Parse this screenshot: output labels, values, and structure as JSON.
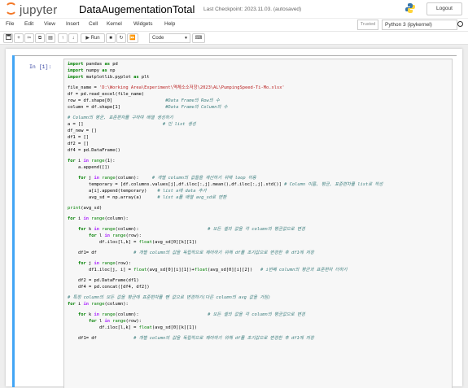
{
  "header": {
    "logo_text": "jupyter",
    "notebook_name": "DataAugementationTotal",
    "checkpoint": "Last Checkpoint: 2023.11.03.",
    "autosave": "(autosaved)",
    "logout_label": "Logout"
  },
  "menu": {
    "items": [
      "File",
      "Edit",
      "View",
      "Insert",
      "Cell",
      "Kernel",
      "Widgets",
      "Help"
    ],
    "trusted": "Trusted",
    "kernel_name": "Python 3 (ipykernel)"
  },
  "toolbar": {
    "run_label": "Run",
    "cell_type": "Code"
  },
  "cell": {
    "prompt": "In [1]:",
    "lines": [
      [
        [
          "kw",
          "import"
        ],
        [
          "t",
          " pandas "
        ],
        [
          "kw",
          "as"
        ],
        [
          "t",
          " pd"
        ]
      ],
      [
        [
          "kw",
          "import"
        ],
        [
          "t",
          " numpy "
        ],
        [
          "kw",
          "as"
        ],
        [
          "t",
          " np"
        ]
      ],
      [
        [
          "kw",
          "import"
        ],
        [
          "t",
          " matplotlib.pyplot "
        ],
        [
          "kw",
          "as"
        ],
        [
          "t",
          " plt"
        ]
      ],
      [],
      [
        [
          "t",
          "file_name = "
        ],
        [
          "str",
          "'D:\\Working Area\\Experiment\\역체소소저장\\2023\\AL\\PumpingSpeed-Ti-Mo.xlsx'"
        ]
      ],
      [
        [
          "t",
          "df = pd.read_excel(file_name)"
        ]
      ],
      [
        [
          "t",
          "row = df.shape[0]                    "
        ],
        [
          "cm",
          "#Data Frame의 Row의 수"
        ]
      ],
      [
        [
          "t",
          "column = df.shape[1]                 "
        ],
        [
          "cm",
          "#Data Frame의 Column의 수"
        ]
      ],
      [],
      [
        [
          "cm",
          "# Column의 평균, 표준편차를 구하여 배열 생성하기"
        ]
      ],
      [
        [
          "t",
          "a = []                              "
        ],
        [
          "cm",
          "# 빈 list 생성"
        ]
      ],
      [
        [
          "t",
          "df_new = []"
        ]
      ],
      [
        [
          "t",
          "df1 = []"
        ]
      ],
      [
        [
          "t",
          "df2 = []"
        ]
      ],
      [
        [
          "t",
          "df4 = pd.DataFrame()"
        ]
      ],
      [],
      [
        [
          "kw",
          "for"
        ],
        [
          "t",
          " i "
        ],
        [
          "op",
          "in"
        ],
        [
          "t",
          " "
        ],
        [
          "bi",
          "range"
        ],
        [
          "t",
          "(1):"
        ]
      ],
      [
        [
          "t",
          "    a.append([])"
        ]
      ],
      [],
      [
        [
          "t",
          "    "
        ],
        [
          "kw",
          "for"
        ],
        [
          "t",
          " j "
        ],
        [
          "op",
          "in"
        ],
        [
          "t",
          " "
        ],
        [
          "bi",
          "range"
        ],
        [
          "t",
          "(column):     "
        ],
        [
          "cm",
          "# 개별 column의 값들을 계산하기 위해 loop 이용"
        ]
      ],
      [
        [
          "t",
          "        temporary = [df.columns.values[j],df.iloc[:,j].mean(),df.iloc[:,j].std()] "
        ],
        [
          "cm",
          "# Column 이름, 평균, 표준편차를 list로 작성"
        ]
      ],
      [
        [
          "t",
          "        a[i].append(temporary)    "
        ],
        [
          "cm",
          "# list a에 data 추가"
        ]
      ],
      [
        [
          "t",
          "        avg_sd = np.array(a)      "
        ],
        [
          "cm",
          "# list a를 배열 avg_sd로 변환"
        ]
      ],
      [],
      [
        [
          "bi",
          "print"
        ],
        [
          "t",
          "(avg_sd)"
        ]
      ],
      [],
      [
        [
          "kw",
          "for"
        ],
        [
          "t",
          " i "
        ],
        [
          "op",
          "in"
        ],
        [
          "t",
          " "
        ],
        [
          "bi",
          "range"
        ],
        [
          "t",
          "(column):"
        ]
      ],
      [],
      [
        [
          "t",
          "    "
        ],
        [
          "kw",
          "for"
        ],
        [
          "t",
          " k "
        ],
        [
          "op",
          "in"
        ],
        [
          "t",
          " "
        ],
        [
          "bi",
          "range"
        ],
        [
          "t",
          "(column):                          "
        ],
        [
          "cm",
          "# 모든 셀의 값을 각 column의 평균값으로 변경"
        ]
      ],
      [
        [
          "t",
          "        "
        ],
        [
          "kw",
          "for"
        ],
        [
          "t",
          " l "
        ],
        [
          "op",
          "in"
        ],
        [
          "t",
          " "
        ],
        [
          "bi",
          "range"
        ],
        [
          "t",
          "(row):"
        ]
      ],
      [
        [
          "t",
          "            df.iloc[l,k] = "
        ],
        [
          "bi",
          "float"
        ],
        [
          "t",
          "(avg_sd[0][k][1])"
        ]
      ],
      [],
      [
        [
          "t",
          "    df1= df              "
        ],
        [
          "cm",
          "# 개별 column의 값을 독립적으로 제어하기 위해 df를 초기값으로 변경한 후 df1에 저장"
        ]
      ],
      [],
      [
        [
          "t",
          "    "
        ],
        [
          "kw",
          "for"
        ],
        [
          "t",
          " j "
        ],
        [
          "op",
          "in"
        ],
        [
          "t",
          " "
        ],
        [
          "bi",
          "range"
        ],
        [
          "t",
          "(row):"
        ]
      ],
      [
        [
          "t",
          "        df1.iloc[j, i] = "
        ],
        [
          "bi",
          "float"
        ],
        [
          "t",
          "(avg_sd[0][i][1])+"
        ],
        [
          "bi",
          "float"
        ],
        [
          "t",
          "(avg_sd[0][i][2])   "
        ],
        [
          "cm",
          "# i번째 column의 평균과 표준편차 더하기"
        ]
      ],
      [],
      [
        [
          "t",
          "    df2 = pd.DataFrame(df1)"
        ]
      ],
      [
        [
          "t",
          "    df4 = pd.concat([df4, df2])"
        ]
      ],
      [],
      [
        [
          "cm",
          "# 특정 column의 모든 값을 평균에 표준편차를 뺀 값으로 변경하기(다른 column의 avg 값을 가짐)"
        ]
      ],
      [
        [
          "kw",
          "for"
        ],
        [
          "t",
          " i "
        ],
        [
          "op",
          "in"
        ],
        [
          "t",
          " "
        ],
        [
          "bi",
          "range"
        ],
        [
          "t",
          "(column):"
        ]
      ],
      [],
      [
        [
          "t",
          "    "
        ],
        [
          "kw",
          "for"
        ],
        [
          "t",
          " k "
        ],
        [
          "op",
          "in"
        ],
        [
          "t",
          " "
        ],
        [
          "bi",
          "range"
        ],
        [
          "t",
          "(column):                          "
        ],
        [
          "cm",
          "# 모든 셀의 값을 각 column의 평균값으로 변경"
        ]
      ],
      [
        [
          "t",
          "        "
        ],
        [
          "kw",
          "for"
        ],
        [
          "t",
          " l "
        ],
        [
          "op",
          "in"
        ],
        [
          "t",
          " "
        ],
        [
          "bi",
          "range"
        ],
        [
          "t",
          "(row):"
        ]
      ],
      [
        [
          "t",
          "            df.iloc[l,k] = "
        ],
        [
          "bi",
          "float"
        ],
        [
          "t",
          "(avg_sd[0][k][1])"
        ]
      ],
      [],
      [
        [
          "t",
          "    df1= df              "
        ],
        [
          "cm",
          "# 개별 column의 값을 독립적으로 제어하기 위해 df를 초기값으로 변경한 후 df1에 저장"
        ]
      ]
    ]
  },
  "colors": {
    "accent": "#f37726",
    "cell_border": "#42a5f5",
    "prompt": "#303f9f"
  }
}
